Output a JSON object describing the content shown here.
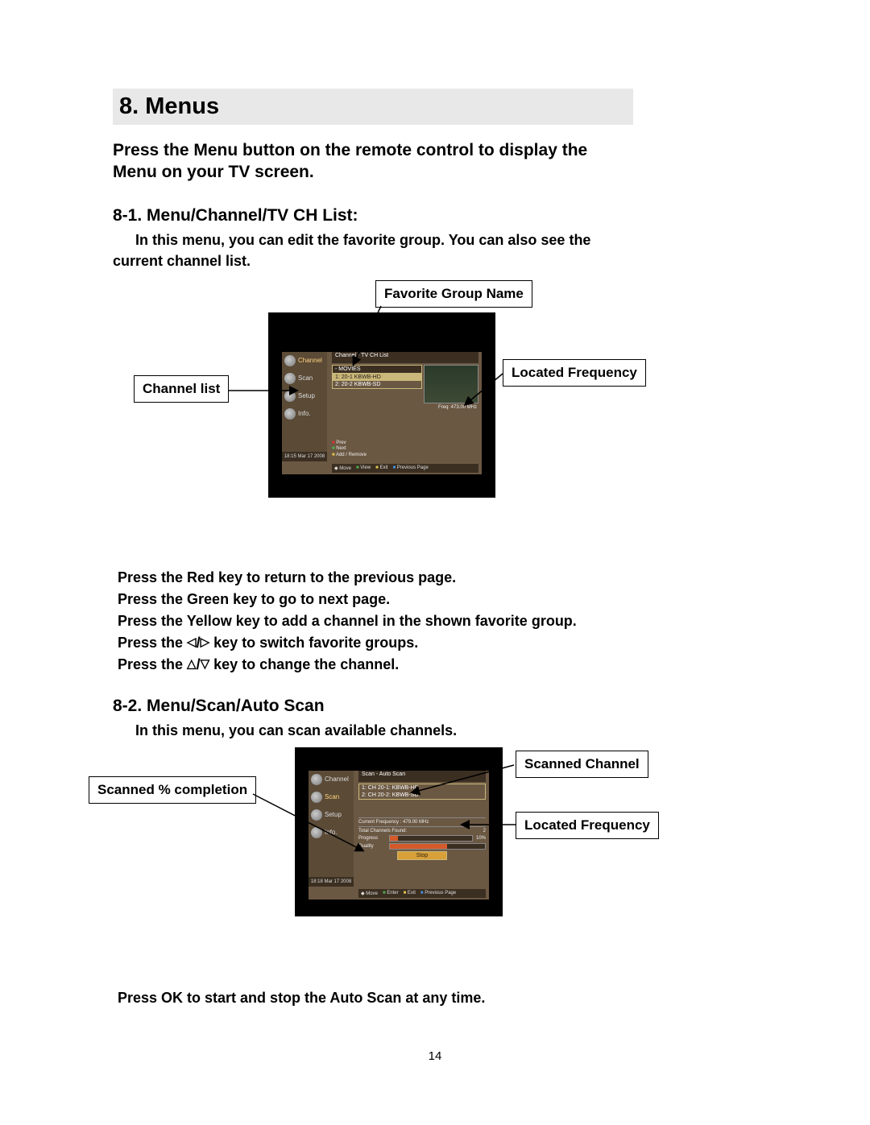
{
  "heading": "8. Menus",
  "intro_l1": "Press the Menu button on the remote control to display the",
  "intro_l2": "Menu on your TV screen.",
  "s1": {
    "title": "8-1. Menu/Channel/TV CH List:",
    "desc_l1": "In this menu, you can edit the favorite group. You can also see the",
    "desc_l2": "current channel list.",
    "callouts": {
      "fav_group": "Favorite Group Name",
      "located_freq": "Located Frequency",
      "channel_list": "Channel list"
    },
    "tv": {
      "menu": {
        "channel": "Channel",
        "scan": "Scan",
        "setup": "Setup",
        "info": "Info."
      },
      "panel_title": "Channel - TV CH List",
      "group": "- MOVIES",
      "rows": [
        "1: 20-1 KBWB-HD",
        "2: 20-2 KBWB-SD"
      ],
      "hints": {
        "prev": "Prev",
        "next": "Next",
        "add": "Add / Remove"
      },
      "freq": "Freq: 473.00 MHz",
      "time": "18:15 Mar 17 2008",
      "footer": {
        "move": "Move",
        "view": "View",
        "exit": "Exit",
        "pp": "Previous Page"
      }
    },
    "instructions": [
      "Press the Red key to return to the previous page.",
      "Press the Green key to go to next page.",
      "Press the Yellow key to add a channel in the shown favorite group."
    ],
    "instr_lr_pre": "Press the  ",
    "instr_lr_post": "  key to switch favorite groups.",
    "instr_ud_pre": "Press the  ",
    "instr_ud_post": "  key to change the channel."
  },
  "s2": {
    "title": "8-2. Menu/Scan/Auto Scan",
    "desc": "In this menu, you can scan available channels.",
    "callouts": {
      "scanned_channel": "Scanned Channel",
      "scanned_pct": "Scanned % completion",
      "located_freq": "Located Frequency"
    },
    "tv": {
      "panel_title": "Scan - Auto Scan",
      "rows": [
        "1: CH 20-1: KBWB-HD",
        "2: CH 20-2: KBWB-SD"
      ],
      "cur_freq": "Current Frequency : 479.00 MHz",
      "total_found_label": "Total Channels Found:",
      "total_found_val": "2",
      "progress_label": "Progress",
      "progress_val": "10%",
      "quality_label": "Quality",
      "stop": "Stop",
      "time": "18:18 Mar 17 2008",
      "footer": {
        "move": "Move",
        "enter": "Enter",
        "exit": "Exit",
        "pp": "Previous Page"
      }
    },
    "after": "Press OK to start and stop the Auto Scan at any time."
  },
  "page_number": "14"
}
